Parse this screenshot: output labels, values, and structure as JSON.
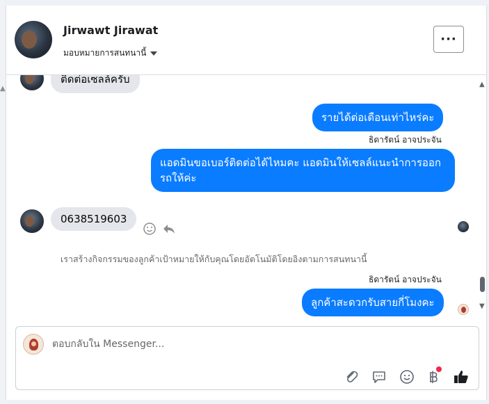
{
  "header": {
    "contact_name": "Jirwawt Jirawat",
    "assign_label": "มอบหมายการสนทนานี้",
    "more_label": "···"
  },
  "thread": {
    "messages": [
      {
        "direction": "in",
        "text": "ติดต่อเซลล์ครับ"
      },
      {
        "direction": "out",
        "text": "รายได้ต่อเดือนเท่าไหร่คะ"
      },
      {
        "direction": "out",
        "sender": "ธิดารัตน์ อาจประจัน",
        "text": "แอดมินขอเบอร์ติดต่อได้ไหมคะ แอดมินให้เซลล์แนะนำการออกรถให้ค่ะ"
      },
      {
        "direction": "in",
        "text": "0638519603"
      },
      {
        "direction": "system",
        "text": "เราสร้างกิจกรรมของลูกค้าเป้าหมายให้กับคุณโดยอัตโนมัติโดยอิงตามการสนทนานี้"
      },
      {
        "direction": "out",
        "sender": "ธิดารัตน์ อาจประจัน",
        "text": "ลูกค้าสะดวกรับสายกี่โมงคะ"
      }
    ]
  },
  "composer": {
    "placeholder": "ตอบกลับใน Messenger...",
    "tools": [
      "paperclip-icon",
      "saved-reply-icon",
      "emoji-icon",
      "baht-payment-icon",
      "thumbs-up-icon"
    ]
  },
  "colors": {
    "outgoing_bubble": "#0a7cff",
    "incoming_bubble": "#e4e6eb",
    "notification_dot": "#f02849"
  }
}
